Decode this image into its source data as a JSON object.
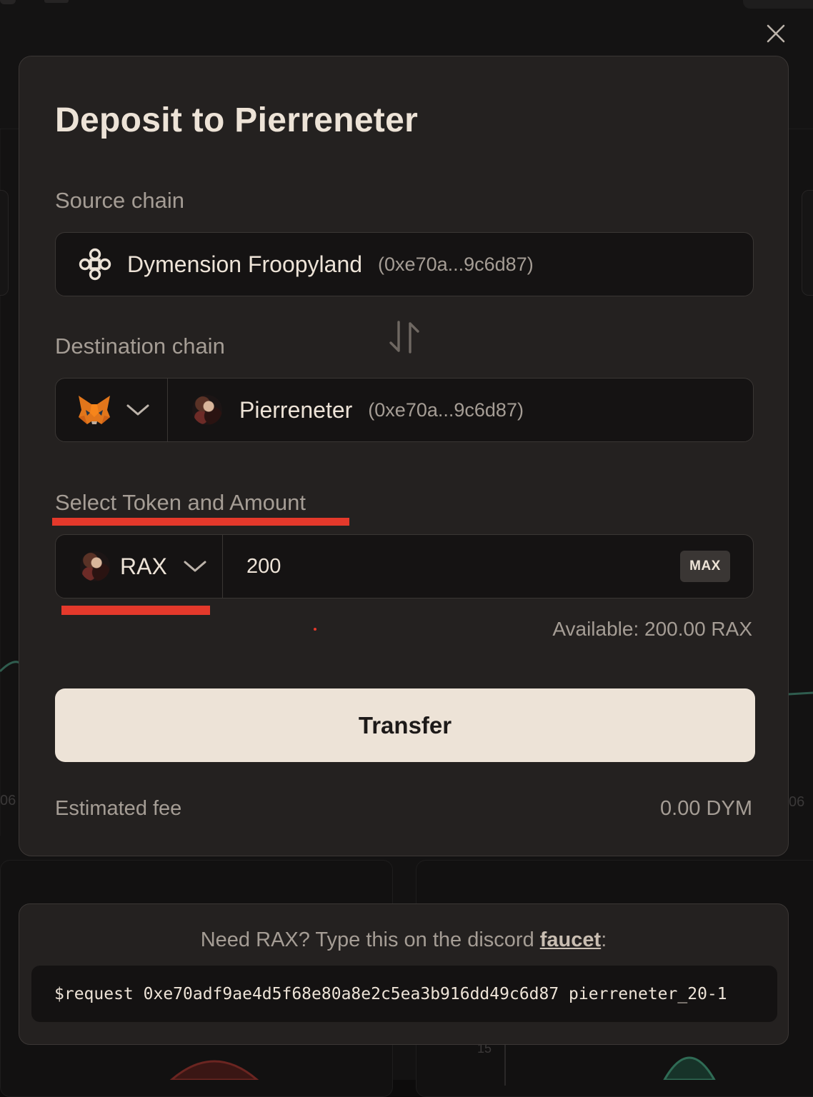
{
  "modal": {
    "title": "Deposit to Pierreneter",
    "source_label": "Source chain",
    "source_chain": {
      "name": "Dymension Froopyland",
      "address": "(0xe70a...9c6d87)",
      "icon": "dymension-logo-icon"
    },
    "destination_label": "Destination chain",
    "destination_chain": {
      "name": "Pierreneter",
      "address": "(0xe70a...9c6d87)",
      "wallet_icon": "metamask-fox-icon"
    },
    "token_label": "Select Token and Amount",
    "token": {
      "symbol": "RAX"
    },
    "amount": {
      "value": "200",
      "placeholder": ""
    },
    "max_label": "MAX",
    "available": "Available: 200.00 RAX",
    "transfer_label": "Transfer",
    "fee_label": "Estimated fee",
    "fee_value": "0.00 DYM"
  },
  "faucet": {
    "prefix": "Need RAX? Type this on the discord ",
    "link": "faucet",
    "suffix": ":",
    "command": "$request 0xe70adf9ae4d5f68e80a8e2c5ea3b916dd49c6d87 pierreneter_20-1"
  },
  "background": {
    "axis_left": "06",
    "axis_right": "06",
    "ytick": "15"
  },
  "colors": {
    "accent_red": "#e4392b",
    "button_bg": "#ede3d7",
    "modal_bg": "#242120"
  }
}
